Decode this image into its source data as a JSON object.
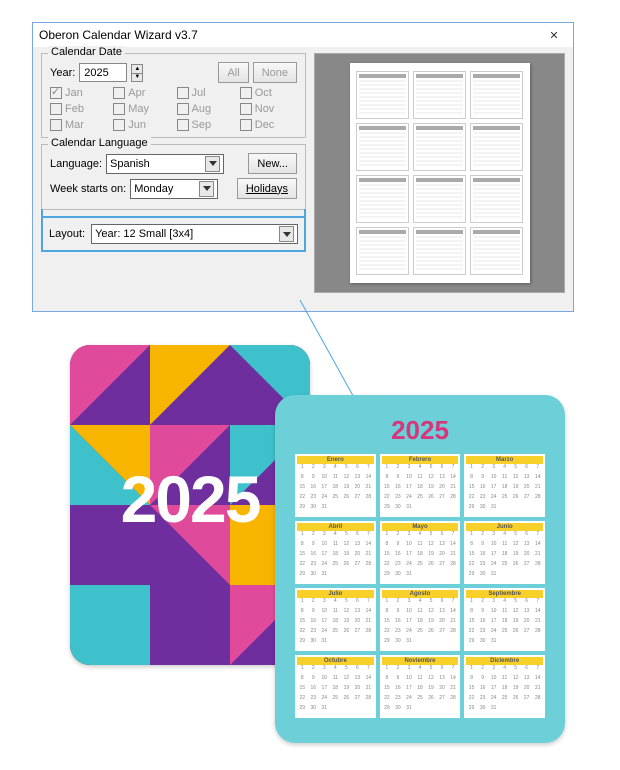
{
  "dialog": {
    "title": "Oberon Calendar Wizard v3.7",
    "calendar_date_group": "Calendar Date",
    "year_label": "Year:",
    "year_value": "2025",
    "all_btn": "All",
    "none_btn": "None",
    "months": [
      {
        "label": "Jan",
        "checked": true
      },
      {
        "label": "Apr",
        "checked": false
      },
      {
        "label": "Jul",
        "checked": false
      },
      {
        "label": "Oct",
        "checked": false
      },
      {
        "label": "Feb",
        "checked": false
      },
      {
        "label": "May",
        "checked": false
      },
      {
        "label": "Aug",
        "checked": false
      },
      {
        "label": "Nov",
        "checked": false
      },
      {
        "label": "Mar",
        "checked": false
      },
      {
        "label": "Jun",
        "checked": false
      },
      {
        "label": "Sep",
        "checked": false
      },
      {
        "label": "Dec",
        "checked": false
      }
    ],
    "calendar_language_group": "Calendar Language",
    "language_label": "Language:",
    "language_value": "Spanish",
    "new_btn": "New...",
    "week_starts_label": "Week starts on:",
    "week_starts_value": "Monday",
    "holidays_btn": "Holidays",
    "layout_label": "Layout:",
    "layout_value": "Year: 12 Small [3x4]"
  },
  "cover": {
    "year": "2025"
  },
  "calendar_preview": {
    "year": "2025",
    "months": [
      "Enero",
      "Febrero",
      "Marzo",
      "Abril",
      "Mayo",
      "Junio",
      "Julio",
      "Agosto",
      "Septiembre",
      "Octubre",
      "Noviembre",
      "Diciembre"
    ]
  }
}
